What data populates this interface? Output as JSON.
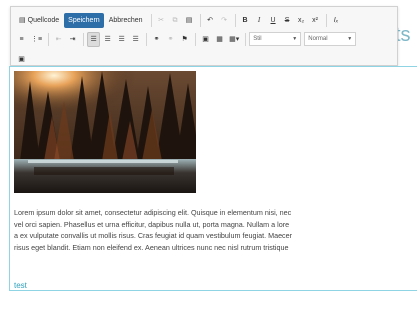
{
  "background": {
    "heading_fragment": "ts"
  },
  "toolbar": {
    "source_label": "Quellcode",
    "save_label": "Speichern",
    "cancel_label": "Abbrechen",
    "styles_value": "Stil",
    "format_value": "Normal"
  },
  "content": {
    "paragraph_lines": [
      "Lorem ipsum dolor sit amet, consectetur adipiscing elit. Quisque in elementum nisi, nec",
      "vel orci sapien. Phasellus et urna efficitur, dapibus nulla ut, porta magna. Nullam a lore",
      "a ex vulputate convallis ut mollis risus. Cras feugiat id quam vestibulum feugiat. Maecer",
      "risus eget blandit. Etiam non eleifend ex. Aenean ultrices nunc nec nisl rutrum tristique"
    ],
    "link_text": "test"
  },
  "colors": {
    "primary_button": "#2e6ea8",
    "focus_border": "#8ed4e4",
    "link": "#31a1bd"
  }
}
